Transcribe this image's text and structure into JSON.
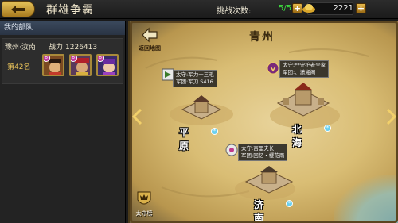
{
  "header": {
    "title": "群雄争霸",
    "challenge_label": "挑战次数:",
    "challenge_value": "5/5",
    "gold_value": "2221",
    "plus_symbol": "+"
  },
  "left_panel": {
    "heading": "我的部队",
    "location": "豫州·汝南",
    "power_label": "战力:1226413",
    "rank": "第42名",
    "heroes": [
      {
        "badge": "6"
      },
      {
        "badge": "6"
      },
      {
        "badge": "6"
      }
    ]
  },
  "map": {
    "region_title": "青州",
    "return_label": "返回地图",
    "defender_label": "太守榜",
    "cities": [
      {
        "name": "平原",
        "info_line1": "太守:军力十三毛",
        "info_line2": "军团:军刀.S416"
      },
      {
        "name": "北海",
        "info_line1": "太守:**守护者全家",
        "info_line2": "军团:、潇湘阁"
      },
      {
        "name": "济南",
        "info_line1": "太守:百里夫长",
        "info_line2": "军团:回忆・樱花雨"
      }
    ]
  },
  "colors": {
    "accent_gold": "#e6b84a",
    "challenge_green": "#3fe03f",
    "rank_gold": "#e8c25a"
  },
  "icons": {
    "back": "back-arrow-icon",
    "gold": "gold-ingot-icon",
    "snow": "snowflake-icon",
    "flag": "city-flag-icon"
  }
}
